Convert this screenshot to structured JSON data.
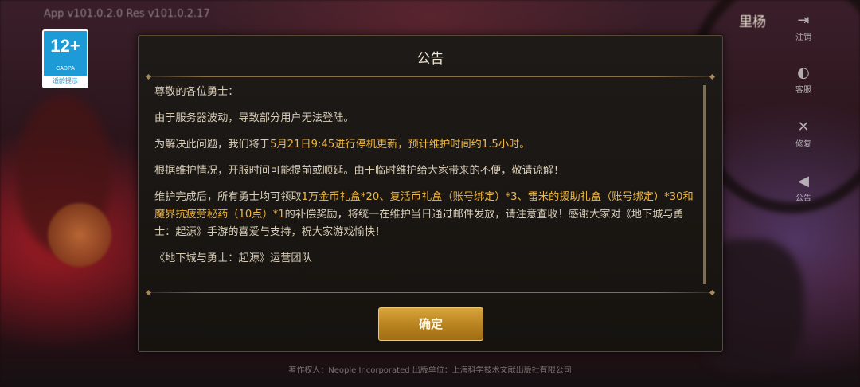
{
  "app": {
    "version": "App v101.0.2.0 Res v101.0.2.17",
    "username": "里杨"
  },
  "age_rating": {
    "number": "12+",
    "org": "CADPA",
    "tip": "适龄提示"
  },
  "side_menu": {
    "items": [
      {
        "label": "注销",
        "icon": "logout-icon"
      },
      {
        "label": "客服",
        "icon": "support-icon"
      },
      {
        "label": "修复",
        "icon": "repair-icon"
      },
      {
        "label": "公告",
        "icon": "announcement-icon"
      }
    ]
  },
  "dialog": {
    "title": "公告",
    "greeting": "尊敬的各位勇士：",
    "p1": "由于服务器波动，导致部分用户无法登陆。",
    "p2_pre": "为解决此问题，我们将于",
    "p2_hl": "5月21日9:45进行停机更新，预计维护时间约1.5小时。",
    "p3": "根据维护情况，开服时间可能提前或顺延。由于临时维护给大家带来的不便，敬请谅解！",
    "p4_pre": "维护完成后，所有勇士均可领取",
    "p4_hl": "1万金币礼盒*20、复活币礼盒（账号绑定）*3、雷米的援助礼盒（账号绑定）*30和魔界抗疲劳秘药（10点）*1",
    "p4_post": "的补偿奖励，将统一在维护当日通过邮件发放，请注意查收！感谢大家对《地下城与勇士：起源》手游的喜爱与支持，祝大家游戏愉快！",
    "signature": "《地下城与勇士：起源》运营团队",
    "confirm_label": "确定"
  },
  "footer": {
    "copyright": "著作权人：Neople Incorporated 出版单位：上海科学技术文献出版社有限公司"
  },
  "colors": {
    "highlight": "#f0b840",
    "button": "#c8922c",
    "badge": "#1d9bd7"
  }
}
